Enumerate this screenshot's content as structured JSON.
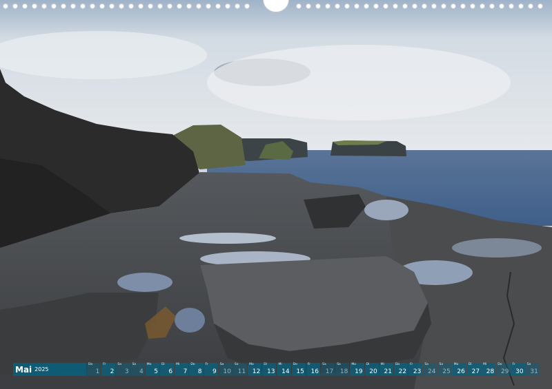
{
  "calendar": {
    "month": "Mai",
    "year": "2025",
    "days": [
      {
        "num": "1",
        "dow": "Do",
        "weekend": true
      },
      {
        "num": "2",
        "dow": "Fr",
        "weekend": false
      },
      {
        "num": "3",
        "dow": "Sa",
        "weekend": true
      },
      {
        "num": "4",
        "dow": "So",
        "weekend": true
      },
      {
        "num": "5",
        "dow": "Mo",
        "weekend": false
      },
      {
        "num": "6",
        "dow": "Di",
        "weekend": false
      },
      {
        "num": "7",
        "dow": "Mi",
        "weekend": false
      },
      {
        "num": "8",
        "dow": "Do",
        "weekend": false
      },
      {
        "num": "9",
        "dow": "Fr",
        "weekend": false
      },
      {
        "num": "10",
        "dow": "Sa",
        "weekend": true
      },
      {
        "num": "11",
        "dow": "So",
        "weekend": true
      },
      {
        "num": "12",
        "dow": "Mo",
        "weekend": false
      },
      {
        "num": "13",
        "dow": "Di",
        "weekend": false
      },
      {
        "num": "14",
        "dow": "Mi",
        "weekend": false
      },
      {
        "num": "15",
        "dow": "Do",
        "weekend": false
      },
      {
        "num": "16",
        "dow": "Fr",
        "weekend": false
      },
      {
        "num": "17",
        "dow": "Sa",
        "weekend": true
      },
      {
        "num": "18",
        "dow": "So",
        "weekend": true
      },
      {
        "num": "19",
        "dow": "Mo",
        "weekend": false
      },
      {
        "num": "20",
        "dow": "Di",
        "weekend": false
      },
      {
        "num": "21",
        "dow": "Mi",
        "weekend": false
      },
      {
        "num": "22",
        "dow": "Do",
        "weekend": false
      },
      {
        "num": "23",
        "dow": "Fr",
        "weekend": false
      },
      {
        "num": "24",
        "dow": "Sa",
        "weekend": true
      },
      {
        "num": "25",
        "dow": "So",
        "weekend": true
      },
      {
        "num": "26",
        "dow": "Mo",
        "weekend": false
      },
      {
        "num": "27",
        "dow": "Di",
        "weekend": false
      },
      {
        "num": "28",
        "dow": "Mi",
        "weekend": false
      },
      {
        "num": "29",
        "dow": "Do",
        "weekend": true
      },
      {
        "num": "30",
        "dow": "Fr",
        "weekend": false
      },
      {
        "num": "31",
        "dow": "Sa",
        "weekend": true
      }
    ]
  },
  "colors": {
    "bar": "#0a607c",
    "sky": "#dfe5ea",
    "sea": "#4f6c92",
    "rock": "#3a3b3d"
  }
}
